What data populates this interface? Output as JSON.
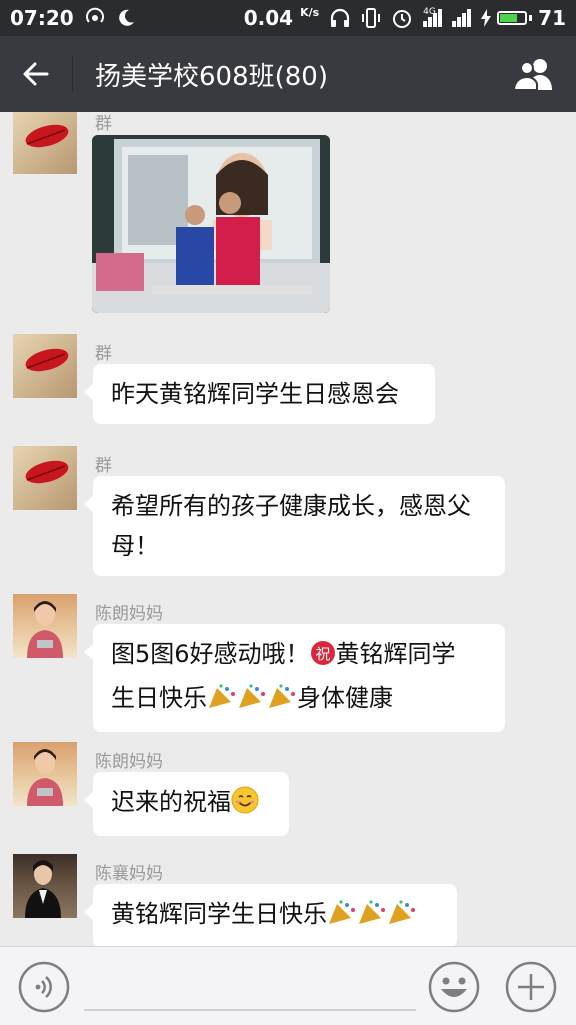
{
  "status_bar": {
    "time": "07:20",
    "speed": "0.04",
    "speed_unit": "K/s",
    "network": "4G",
    "battery": "71"
  },
  "header": {
    "title": "扬美学校608班(80)"
  },
  "messages": [
    {
      "sender": "群",
      "type": "image"
    },
    {
      "sender": "群",
      "text": "昨天黄铭辉同学生日感恩会"
    },
    {
      "sender": "群",
      "line1": "希望所有的孩子健康成长，感恩父",
      "line2": "母！"
    },
    {
      "sender": "陈朗妈妈",
      "line1_a": "图5图6好感动哦！",
      "line1_emoji": "祝",
      "line1_b": "黄铭辉同学",
      "line2_a": "生日快乐",
      "line2_b": "身体健康"
    },
    {
      "sender": "陈朗妈妈",
      "text": "迟来的祝福"
    },
    {
      "sender": "陈襄妈妈",
      "text": "黄铭辉同学生日快乐"
    }
  ],
  "colors": {
    "title_bar": "#393a3f",
    "status_bar": "#2b2c30",
    "chat_bg": "#ebebeb",
    "bubble": "#ffffff"
  }
}
